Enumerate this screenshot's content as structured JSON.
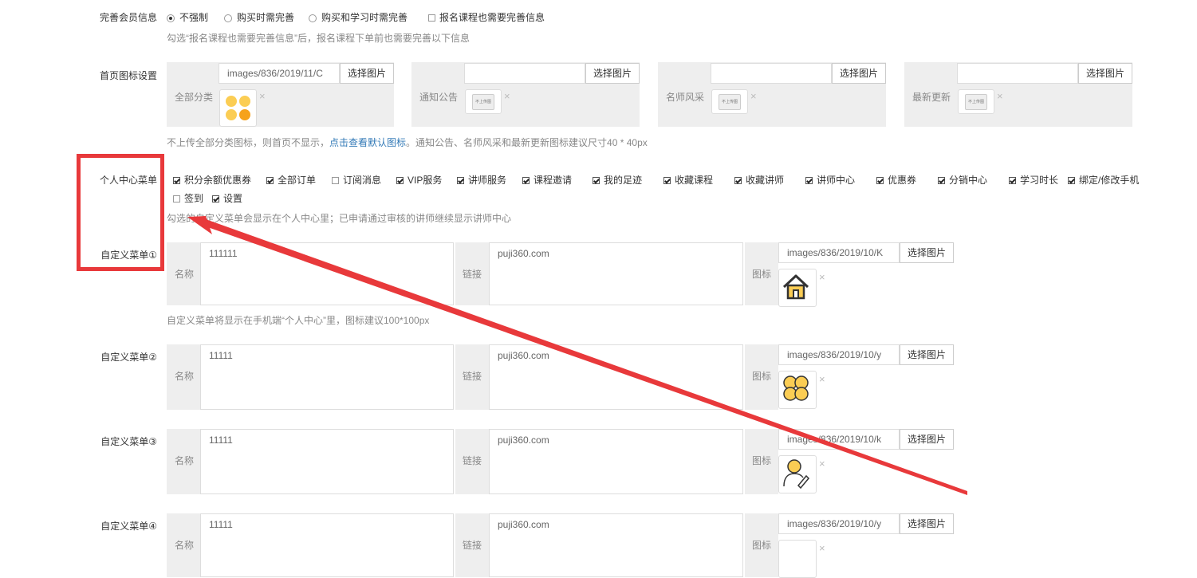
{
  "member_info": {
    "label": "完善会员信息",
    "options": [
      "不强制",
      "购买时需完善",
      "购买和学习时需完善"
    ],
    "checkbox_label": "报名课程也需要完善信息",
    "hint": "勾选“报名课程也需要完善信息”后，报名课程下单前也需要完善以下信息"
  },
  "home_icons": {
    "label": "首页图标设置",
    "select_label": "选择图片",
    "items": [
      {
        "name": "全部分类",
        "path": "images/836/2019/11/C"
      },
      {
        "name": "通知公告",
        "path": ""
      },
      {
        "name": "名师风采",
        "path": ""
      },
      {
        "name": "最新更新",
        "path": ""
      }
    ],
    "placeholder_text": "不上传图",
    "hint_before": "不上传全部分类图标，则首页不显示，",
    "hint_link": "点击查看默认图标",
    "hint_after": "。通知公告、名师风采和最新更新图标建议尺寸40 * 40px"
  },
  "personal_menu": {
    "label": "个人中心菜单",
    "items": [
      {
        "label": "积分余额优惠券",
        "checked": true
      },
      {
        "label": "全部订单",
        "checked": true
      },
      {
        "label": "订阅消息",
        "checked": false
      },
      {
        "label": "VIP服务",
        "checked": true
      },
      {
        "label": "讲师服务",
        "checked": true
      },
      {
        "label": "课程邀请",
        "checked": true
      },
      {
        "label": "我的足迹",
        "checked": true
      },
      {
        "label": "收藏课程",
        "checked": true
      },
      {
        "label": "收藏讲师",
        "checked": true
      },
      {
        "label": "讲师中心",
        "checked": true
      },
      {
        "label": "优惠券",
        "checked": true
      },
      {
        "label": "分销中心",
        "checked": true
      },
      {
        "label": "学习时长",
        "checked": true
      },
      {
        "label": "绑定/修改手机",
        "checked": true
      },
      {
        "label": "签到",
        "checked": false
      },
      {
        "label": "设置",
        "checked": true
      }
    ],
    "hint": "勾选的自定义菜单会显示在个人中心里；已申请通过审核的讲师继续显示讲师中心"
  },
  "custom_menus": {
    "name_label": "名称",
    "link_label": "链接",
    "icon_label": "图标",
    "select_label": "选择图片",
    "hint": "自定义菜单将显示在手机端“个人中心”里，图标建议100*100px",
    "items": [
      {
        "label": "自定义菜单①",
        "name": "111111",
        "link": "puji360.com",
        "icon_path": "images/836/2019/10/K",
        "icon": "house-icon"
      },
      {
        "label": "自定义菜单②",
        "name": "11111",
        "link": "puji360.com",
        "icon_path": "images/836/2019/10/y",
        "icon": "clover-icon"
      },
      {
        "label": "自定义菜单③",
        "name": "11111",
        "link": "puji360.com",
        "icon_path": "images/836/2019/10/k",
        "icon": "user-edit-icon"
      },
      {
        "label": "自定义菜单④",
        "name": "11111",
        "link": "puji360.com",
        "icon_path": "images/836/2019/10/y",
        "icon": "unknown-icon"
      }
    ]
  },
  "annotation": {
    "box_color": "#e8393b",
    "arrow_color": "#e8393b"
  }
}
